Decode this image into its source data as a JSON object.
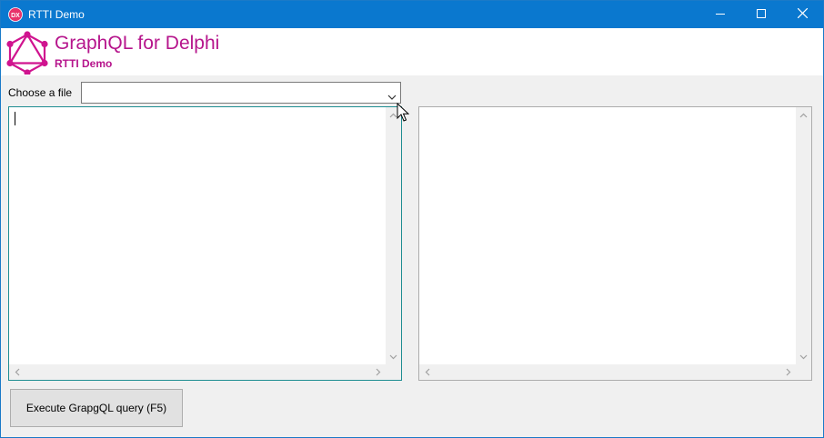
{
  "window": {
    "title": "RTTI Demo",
    "icon": "dx-app-icon"
  },
  "header": {
    "app_name": "GraphQL for Delphi",
    "app_subtitle": "RTTI Demo",
    "logo": "graphql-logo"
  },
  "file_chooser": {
    "label": "Choose a file",
    "selected": ""
  },
  "query_editor": {
    "content": ""
  },
  "result_viewer": {
    "content": ""
  },
  "actions": {
    "execute_label": "Execute GrapgQL query (F5)"
  },
  "colors": {
    "titlebar": "#0a78cf",
    "brand": "#b6158c",
    "focus_border": "#1f8e92"
  }
}
